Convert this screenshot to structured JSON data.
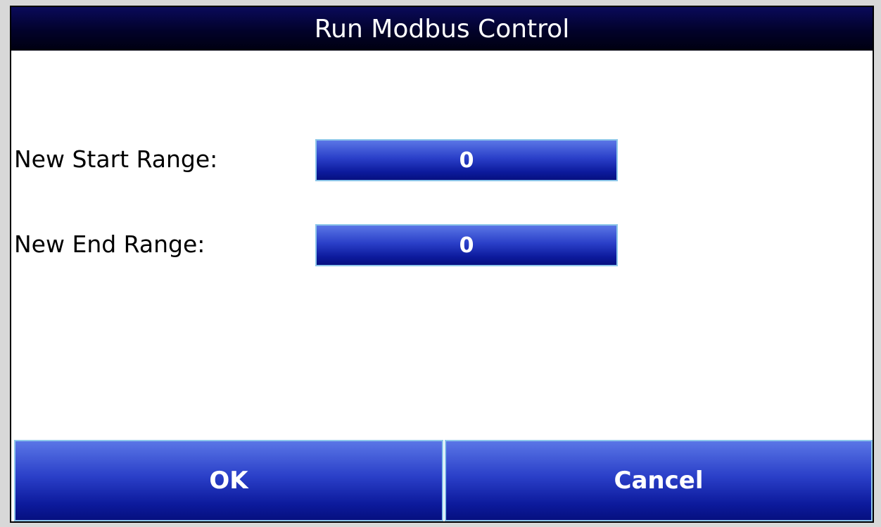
{
  "window": {
    "title": "Run Modbus Control"
  },
  "form": {
    "start": {
      "label": "New Start Range:",
      "value": "0"
    },
    "end": {
      "label": "New End Range:",
      "value": "0"
    }
  },
  "buttons": {
    "ok_label": "OK",
    "cancel_label": "Cancel"
  },
  "colors": {
    "titlebar": "#000020",
    "button_top": "#5a76e6",
    "button_bottom": "#061080",
    "button_border": "#8ec7ea",
    "text_light": "#ffffff",
    "background": "#ffffff"
  }
}
